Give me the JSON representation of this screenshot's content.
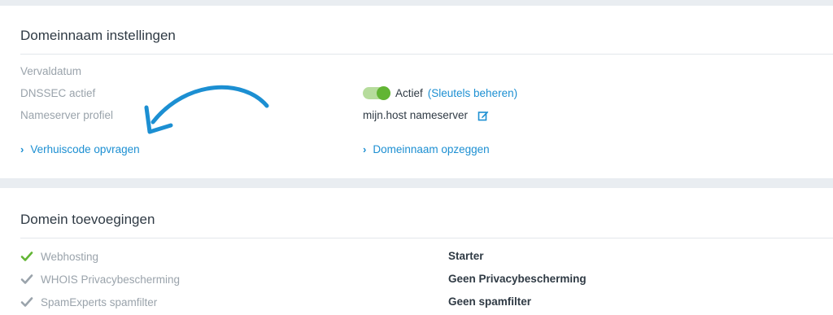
{
  "settings": {
    "title": "Domeinnaam instellingen",
    "rows": [
      {
        "label": "Vervaldatum",
        "value": ""
      },
      {
        "label": "DNSSEC actief",
        "status": "Actief",
        "link": "(Sleutels beheren)"
      },
      {
        "label": "Nameserver profiel",
        "value": "mijn.host nameserver"
      }
    ],
    "actions": {
      "transfer_code": "Verhuiscode opvragen",
      "cancel_domain": "Domeinnaam opzeggen"
    },
    "dnssec_enabled": true
  },
  "addons": {
    "title": "Domein toevoegingen",
    "rows": [
      {
        "label": "Webhosting",
        "value": "Starter",
        "check_color": "#62b534"
      },
      {
        "label": "WHOIS Privacybescherming",
        "value": "Geen Privacybescherming",
        "check_color": "#9aa3ab"
      },
      {
        "label": "SpamExperts spamfilter",
        "value": "Geen spamfilter",
        "check_color": "#9aa3ab"
      }
    ]
  },
  "icons": {
    "chevron": "chevron-right-icon",
    "edit": "edit-icon",
    "check": "check-icon",
    "annotation": "curved-arrow-icon"
  },
  "colors": {
    "accent": "#1c8fd2",
    "toggle_on": "#62b534",
    "muted": "#9aa3ab",
    "text": "#2f3a44"
  }
}
